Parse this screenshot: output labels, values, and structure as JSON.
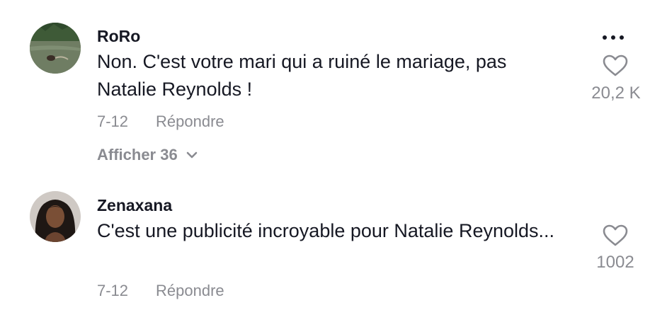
{
  "comments": [
    {
      "username": "RoRo",
      "text": "Non. C'est votre mari qui a ruiné le mariage, pas Natalie Reynolds !",
      "date": "7-12",
      "reply_label": "Répondre",
      "likes": "20,2 K",
      "view_replies_label": "Afficher 36",
      "avatar_icon": "lake-swimmer-photo"
    },
    {
      "username": "Zenaxana",
      "text": "C'est une publicité incroyable pour Natalie Reynolds...",
      "date": "7-12",
      "reply_label": "Répondre",
      "likes": "1002",
      "avatar_icon": "portrait-photo"
    }
  ],
  "colors": {
    "primary_text": "#161823",
    "secondary_text": "#8a8b91"
  }
}
